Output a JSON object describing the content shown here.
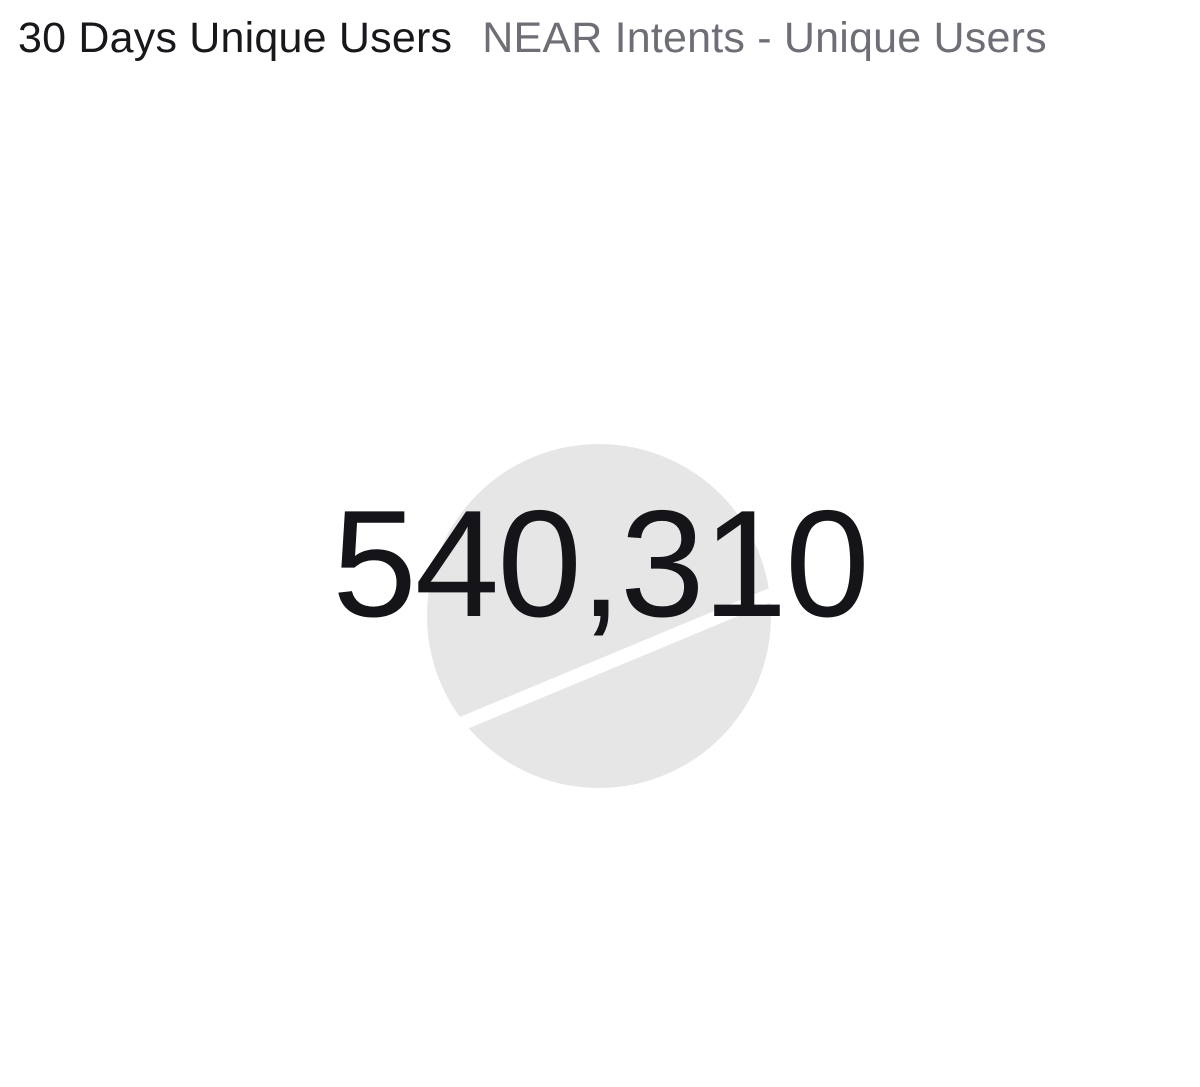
{
  "widget": {
    "title": "30 Days Unique Users",
    "subtitle": "NEAR Intents - Unique Users",
    "value": "540,310"
  },
  "colors": {
    "title": "#17171c",
    "subtitle": "#6e6e76",
    "value": "#141419",
    "watermark": "#e6e6e6",
    "background": "#ffffff"
  },
  "icons": {
    "watermark": "logo-watermark-icon"
  }
}
